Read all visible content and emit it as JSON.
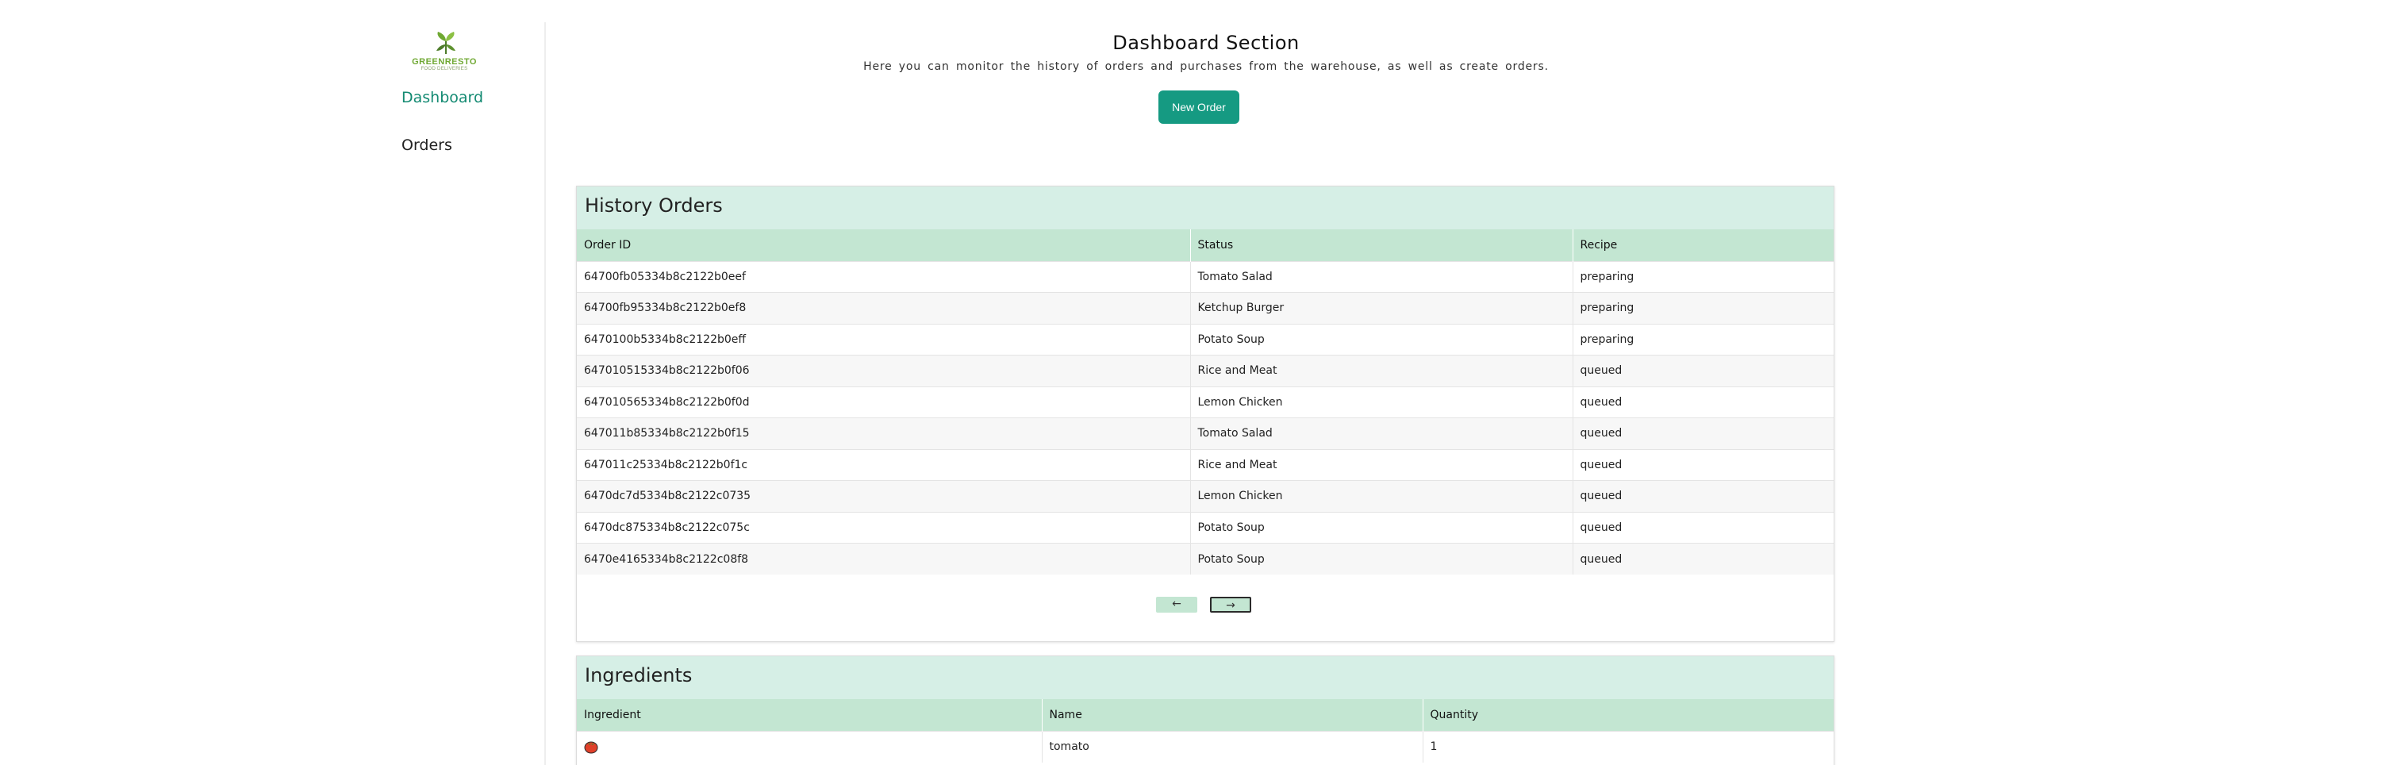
{
  "sidebar": {
    "logo": {
      "brand": "GREENRESTO",
      "tagline": "FOOD DELIVERIES"
    },
    "items": [
      {
        "label": "Dashboard",
        "active": true
      },
      {
        "label": "Orders",
        "active": false
      }
    ]
  },
  "header": {
    "title": "Dashboard Section",
    "subtitle": "Here you can monitor the history of orders and purchases from the warehouse, as well as create orders.",
    "new_order_label": "New Order"
  },
  "history": {
    "title": "History Orders",
    "columns": [
      "Order ID",
      "Status",
      "Recipe"
    ],
    "rows": [
      [
        "64700fb05334b8c2122b0eef",
        "Tomato Salad",
        "preparing"
      ],
      [
        "64700fb95334b8c2122b0ef8",
        "Ketchup Burger",
        "preparing"
      ],
      [
        "6470100b5334b8c2122b0eff",
        "Potato Soup",
        "preparing"
      ],
      [
        "647010515334b8c2122b0f06",
        "Rice and Meat",
        "queued"
      ],
      [
        "647010565334b8c2122b0f0d",
        "Lemon Chicken",
        "queued"
      ],
      [
        "647011b85334b8c2122b0f15",
        "Tomato Salad",
        "queued"
      ],
      [
        "647011c25334b8c2122b0f1c",
        "Rice and Meat",
        "queued"
      ],
      [
        "6470dc7d5334b8c2122c0735",
        "Lemon Chicken",
        "queued"
      ],
      [
        "6470dc875334b8c2122c075c",
        "Potato Soup",
        "queued"
      ],
      [
        "6470e4165334b8c2122c08f8",
        "Potato Soup",
        "queued"
      ]
    ],
    "prev_label": "←",
    "next_label": "→"
  },
  "ingredients": {
    "title": "Ingredients",
    "columns": [
      "Ingredient",
      "Name",
      "Quantity"
    ],
    "rows": [
      {
        "icon": "tomato-icon",
        "name": "tomato",
        "quantity": "1"
      }
    ]
  },
  "colors": {
    "accent": "#159a82",
    "active_nav": "#138a72",
    "card_header": "#d6efe6",
    "table_header": "#c3e6d2"
  }
}
